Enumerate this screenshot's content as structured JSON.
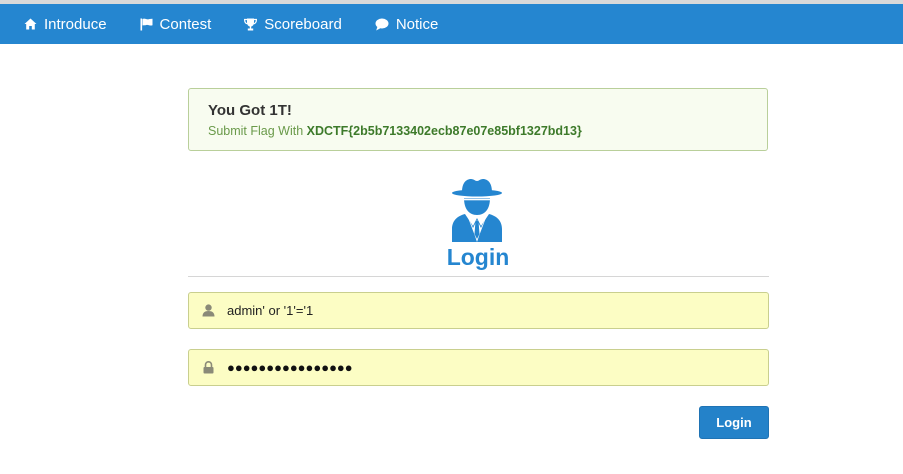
{
  "nav": {
    "items": [
      {
        "label": "Introduce",
        "icon": "home-icon"
      },
      {
        "label": "Contest",
        "icon": "flag-icon"
      },
      {
        "label": "Scoreboard",
        "icon": "trophy-icon"
      },
      {
        "label": "Notice",
        "icon": "comment-icon"
      }
    ]
  },
  "alert": {
    "title": "You Got 1T!",
    "body_prefix": "Submit Flag With ",
    "flag": "XDCTF{2b5b7133402ecb87e07e85bf1327bd13}"
  },
  "login": {
    "title": "Login",
    "username_value": "admin' or '1'='1",
    "password_mask": "●●●●●●●●●●●●●●●●",
    "submit_label": "Login"
  },
  "colors": {
    "navbar": "#2586d0",
    "accent": "#2586d0",
    "alert_bg": "#f8fcf0",
    "field_bg": "#fcfdc4",
    "button": "#2482c9"
  }
}
